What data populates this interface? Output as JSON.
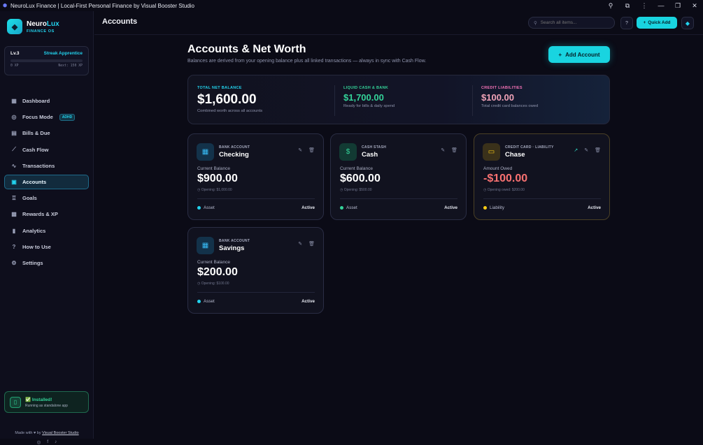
{
  "window": {
    "title": "NeuroLux Finance | Local-First Personal Finance by Visual Booster Studio",
    "controls": [
      "search-icon",
      "extension-icon",
      "more-icon",
      "minimize-icon",
      "restore-icon",
      "close-icon"
    ]
  },
  "brand": {
    "name_a": "Neuro",
    "name_b": "Lux",
    "subtitle": "FINANCE OS"
  },
  "level": {
    "level": "Lv.3",
    "streak": "Streak Apprentice",
    "xp": "0 XP",
    "next": "Next: 150 XP",
    "progress_fraction": 0.0
  },
  "nav": {
    "items": [
      {
        "label": "Dashboard",
        "icon": "grid-icon"
      },
      {
        "label": "Focus Mode",
        "icon": "target-icon",
        "badge": "ADHD"
      },
      {
        "label": "Bills & Due",
        "icon": "receipt-icon"
      },
      {
        "label": "Cash Flow",
        "icon": "chart-line-icon"
      },
      {
        "label": "Transactions",
        "icon": "activity-icon"
      },
      {
        "label": "Accounts",
        "icon": "wallet-icon",
        "active": true
      },
      {
        "label": "Goals",
        "icon": "trophy-icon"
      },
      {
        "label": "Rewards & XP",
        "icon": "gift-icon"
      },
      {
        "label": "Analytics",
        "icon": "bar-chart-icon"
      },
      {
        "label": "How to Use",
        "icon": "help-circle-icon"
      },
      {
        "label": "Settings",
        "icon": "gear-icon"
      }
    ]
  },
  "installed": {
    "title": "✅ Installed!",
    "subtitle": "Running as standalone app"
  },
  "footer": {
    "made_prefix": "Made with",
    "made_by": "by",
    "studio": "Visual Booster Studio"
  },
  "topbar": {
    "page_title": "Accounts",
    "search_placeholder": "Search all items...",
    "help": "?",
    "quick_add": "Quick Add"
  },
  "main": {
    "title": "Accounts & Net Worth",
    "subtitle": "Balances are derived from your opening balance plus all linked transactions — always in sync with Cash Flow.",
    "add_account": "Add Account"
  },
  "summary": [
    {
      "label": "TOTAL NET BALANCE",
      "value": "$1,600.00",
      "desc": "Combined worth across all accounts",
      "color": "#22d3ee"
    },
    {
      "label": "LIQUID CASH & BANK",
      "value": "$1,700.00",
      "desc": "Ready for bills & daily spend",
      "color": "#34d399"
    },
    {
      "label": "CREDIT LIABILITIES",
      "value": "$100.00",
      "desc": "Total credit card balances owed",
      "color": "#f472b6"
    }
  ],
  "accounts": [
    {
      "type": "BANK ACCOUNT",
      "name": "Checking",
      "balance_label": "Current Balance",
      "balance": "$900.00",
      "opening": "Opening: $1,000.00",
      "kind": "Asset",
      "status": "Active",
      "icon": "bank-icon",
      "dot_color": "#22d3ee"
    },
    {
      "type": "CASH STASH",
      "name": "Cash",
      "balance_label": "Current Balance",
      "balance": "$600.00",
      "opening": "Opening: $500.00",
      "kind": "Asset",
      "status": "Active",
      "icon": "dollar-icon",
      "dot_color": "#34d399"
    },
    {
      "type": "CREDIT CARD · LIABILITY",
      "name": "Chase",
      "balance_label": "Amount Owed",
      "balance": "-$100.00",
      "opening": "Opening owed: $200.00",
      "kind": "Liability",
      "status": "Active",
      "icon": "credit-card-icon",
      "dot_color": "#facc15"
    },
    {
      "type": "BANK ACCOUNT",
      "name": "Savings",
      "balance_label": "Current Balance",
      "balance": "$200.00",
      "opening": "Opening: $100.00",
      "kind": "Asset",
      "status": "Active",
      "icon": "bank-icon",
      "dot_color": "#22d3ee"
    }
  ]
}
